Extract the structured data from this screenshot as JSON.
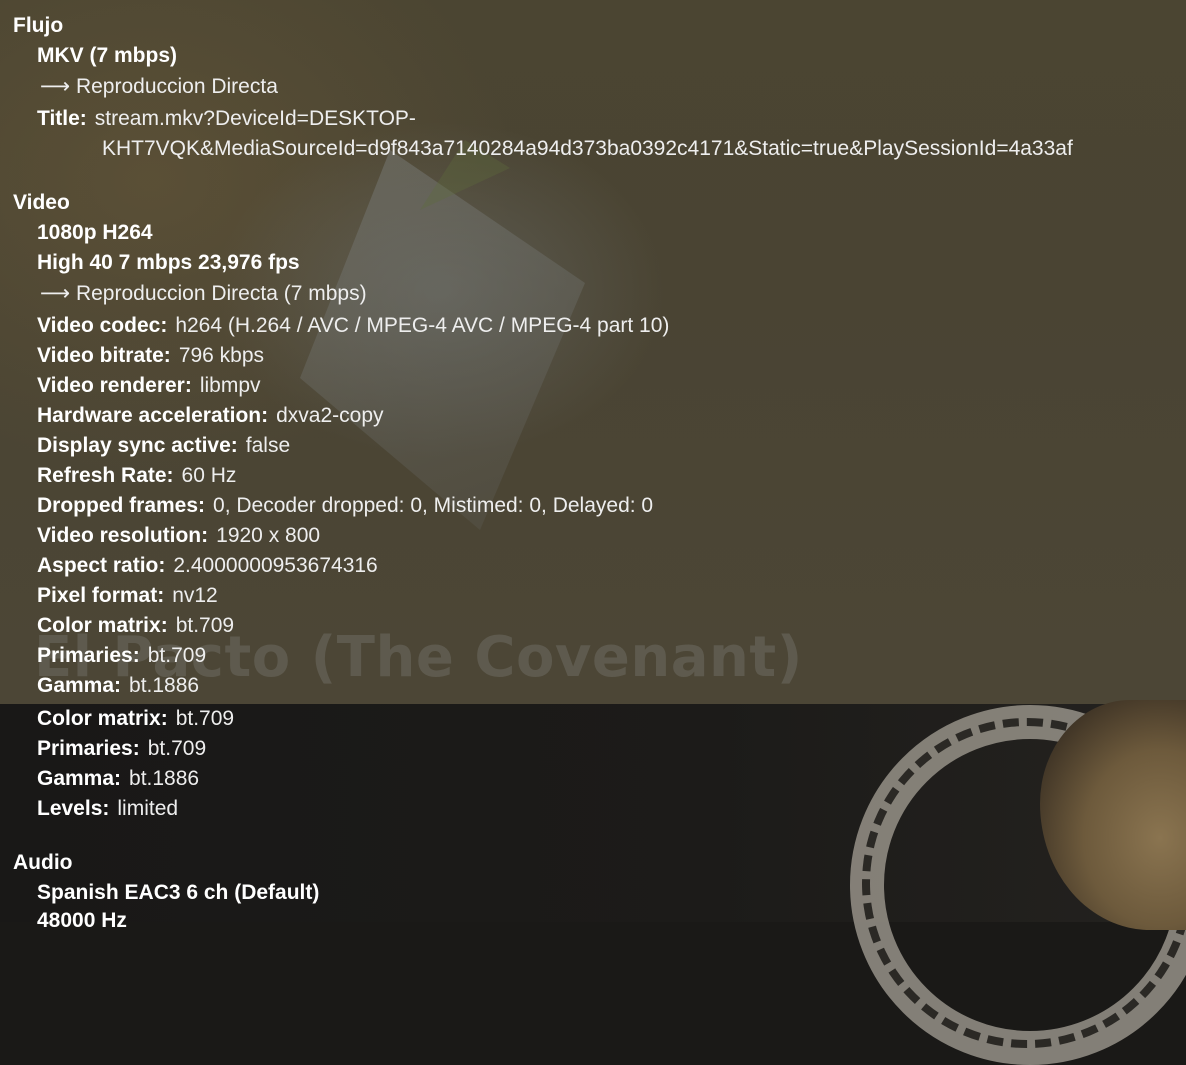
{
  "background": {
    "movie_title": "El Pacto (The Covenant)"
  },
  "stream": {
    "heading": "Flujo",
    "container": "MKV (7 mbps)",
    "mode": "⟶ Reproduccion Directa",
    "title_label": "Title:",
    "title_line1": "stream.mkv?DeviceId=DESKTOP-",
    "title_line2": "KHT7VQK&MediaSourceId=d9f843a7140284a94d373ba0392c4171&Static=true&PlaySessionId=4a33af"
  },
  "video": {
    "heading": "Video",
    "resolution_codec": "1080p H264",
    "profile": "High 40 7 mbps 23,976 fps",
    "mode": "⟶ Reproduccion Directa (7 mbps)",
    "stats": [
      {
        "label": "Video codec:",
        "value": "h264 (H.264 / AVC / MPEG-4 AVC / MPEG-4 part 10)"
      },
      {
        "label": "Video bitrate:",
        "value": "796 kbps"
      },
      {
        "label": "Video renderer:",
        "value": "libmpv"
      },
      {
        "label": "Hardware acceleration:",
        "value": "dxva2-copy"
      },
      {
        "label": "Display sync active:",
        "value": "false"
      },
      {
        "label": "Refresh Rate:",
        "value": "60 Hz"
      },
      {
        "label": "Dropped frames:",
        "value": "0, Decoder dropped: 0, Mistimed: 0, Delayed: 0"
      },
      {
        "label": "Video resolution:",
        "value": "1920 x 800"
      },
      {
        "label": "Aspect ratio:",
        "value": "2.4000000953674316"
      },
      {
        "label": "Pixel format:",
        "value": "nv12"
      },
      {
        "label": "Color matrix:",
        "value": "bt.709"
      },
      {
        "label": "Primaries:",
        "value": "bt.709"
      },
      {
        "label": "Gamma:",
        "value": "bt.1886"
      },
      {
        "label": "Color matrix:",
        "value": "bt.709"
      },
      {
        "label": "Primaries:",
        "value": "bt.709"
      },
      {
        "label": "Gamma:",
        "value": "bt.1886"
      },
      {
        "label": "Levels:",
        "value": "limited"
      }
    ]
  },
  "audio": {
    "heading": "Audio",
    "track": "Spanish EAC3 6 ch (Default)",
    "sample_rate": "48000 Hz"
  }
}
